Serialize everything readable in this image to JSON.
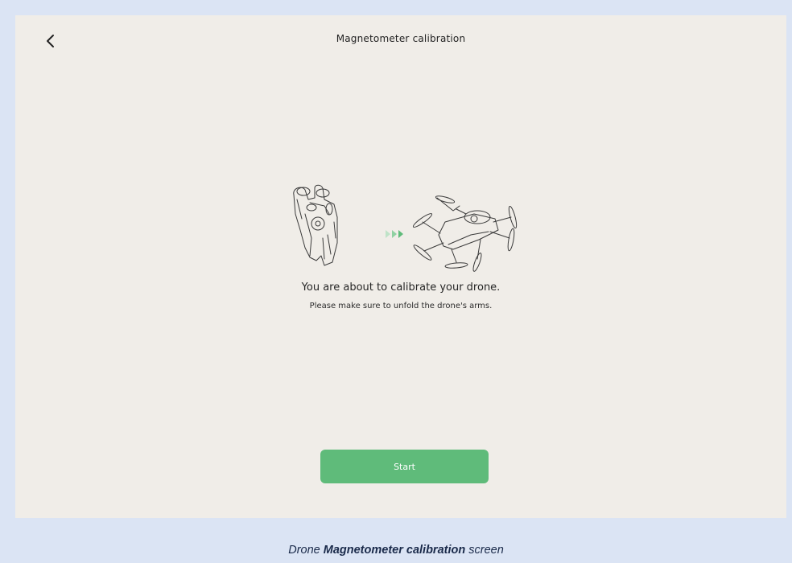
{
  "header": {
    "title": "Magnetometer calibration",
    "back_icon": "chevron-left-icon"
  },
  "body": {
    "main_message": "You are about to calibrate your drone.",
    "sub_message": "Please make sure to unfold the drone's arms.",
    "illustration": {
      "left": "folded-drone",
      "arrow": "triple-chevron-right-icon",
      "right": "unfolded-drone"
    }
  },
  "actions": {
    "start_label": "Start"
  },
  "caption": {
    "prefix": "Drone",
    "bold": "Magnetometer calibration",
    "suffix": "screen"
  },
  "colors": {
    "accent": "#5fbb7a",
    "screen_bg": "#f0ede8",
    "outer_bg": "#dbe4f4"
  }
}
